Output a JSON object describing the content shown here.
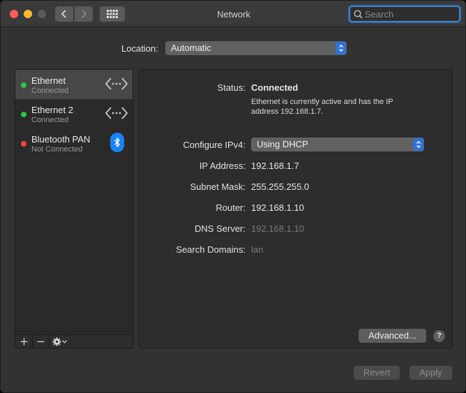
{
  "window": {
    "title": "Network"
  },
  "toolbar": {
    "search_placeholder": "Search"
  },
  "location": {
    "label": "Location:",
    "value": "Automatic"
  },
  "services": [
    {
      "name": "Ethernet",
      "status": "Connected",
      "indicator": "green",
      "icon": "ethernet-arrows-icon",
      "selected": true
    },
    {
      "name": "Ethernet 2",
      "status": "Connected",
      "indicator": "green",
      "icon": "ethernet-arrows-icon",
      "selected": false
    },
    {
      "name": "Bluetooth PAN",
      "status": "Not Connected",
      "indicator": "red",
      "icon": "bluetooth-icon",
      "selected": false
    }
  ],
  "detail": {
    "status_label": "Status:",
    "status_value": "Connected",
    "status_description": "Ethernet is currently active and has the IP address 192.168.1.7.",
    "configure_label": "Configure IPv4:",
    "configure_value": "Using DHCP",
    "ip_label": "IP Address:",
    "ip_value": "192.168.1.7",
    "subnet_label": "Subnet Mask:",
    "subnet_value": "255.255.255.0",
    "router_label": "Router:",
    "router_value": "192.168.1.10",
    "dns_label": "DNS Server:",
    "dns_value": "192.168.1.10",
    "search_domains_label": "Search Domains:",
    "search_domains_value": "lan",
    "advanced_label": "Advanced...",
    "help_label": "?"
  },
  "footer": {
    "revert_label": "Revert",
    "apply_label": "Apply"
  },
  "colors": {
    "accent": "#2f72d6",
    "connected": "#28c840",
    "not_connected": "#ff453a",
    "bluetooth": "#1a82fb"
  }
}
